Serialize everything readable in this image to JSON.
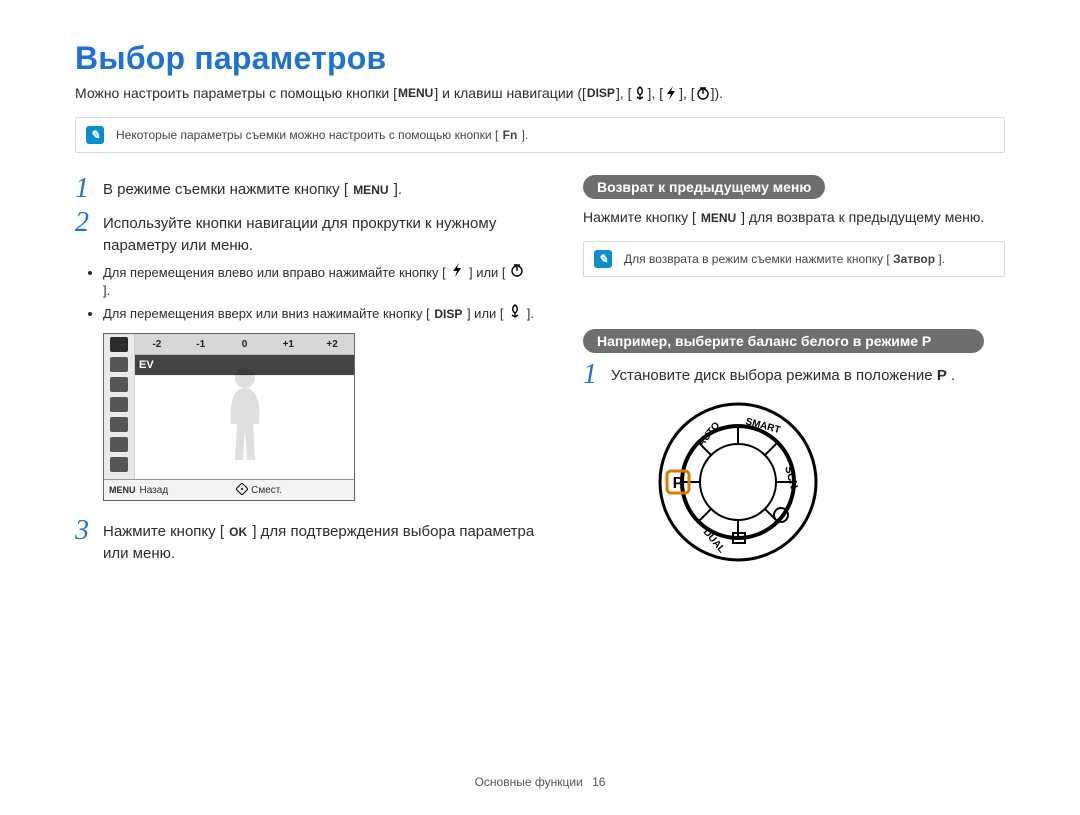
{
  "title": "Выбор параметров",
  "intro": {
    "part1": "Можно настроить параметры с помощью кнопки [",
    "menu_label": "MENU",
    "part2": "] и клавиш навигации ([",
    "disp_label": "DISP",
    "mid1": "], [",
    "mid2": "], [",
    "mid3": "], [",
    "end": "])."
  },
  "tip1": {
    "pre": "Некоторые параметры съемки можно настроить с помощью кнопки [",
    "fn_label": "Fn",
    "post": "]."
  },
  "steps": {
    "s1": {
      "pre": "В режиме съемки нажмите кнопку [",
      "menu_label": "MENU",
      "post": "]."
    },
    "s2": "Используйте кнопки навигации для прокрутки к нужному параметру или меню.",
    "s2_bullets": {
      "b1": {
        "pre": "Для перемещения влево или вправо нажимайте кнопку [",
        "mid": "] или [",
        "post": "]."
      },
      "b2": {
        "pre": "Для перемещения вверх или вниз нажимайте кнопку [",
        "disp_label": "DISP",
        "mid": "] или [",
        "post": "]."
      }
    },
    "s3": {
      "pre": "Нажмите кнопку [",
      "ok_label": "OK",
      "post": "] для подтверждения выбора параметра или меню."
    }
  },
  "lcd": {
    "ev_scale": [
      "-2",
      "-1",
      "0",
      "+1",
      "+2"
    ],
    "ev_label": "EV",
    "menu_small": "MENU",
    "back": "Назад",
    "move": "Смест."
  },
  "right": {
    "heading1": "Возврат к предыдущему меню",
    "p1": {
      "pre": "Нажмите кнопку [",
      "menu_label": "MENU",
      "post": "] для возврата к предыдущему меню."
    },
    "tip2": {
      "pre": "Для возврата в режим съемки нажмите кнопку [",
      "shutter": "Затвор",
      "post": "]."
    },
    "heading2": "Например, выберите баланс белого в режиме P",
    "step1": {
      "pre": "Установите диск выбора режима в положение ",
      "mode_p": "P",
      "post": "."
    }
  },
  "dial": {
    "modes": [
      "AUTO",
      "SMART",
      "SCN",
      "DUAL"
    ],
    "selected": "P"
  },
  "footer": {
    "section": "Основные функции",
    "page": "16"
  }
}
